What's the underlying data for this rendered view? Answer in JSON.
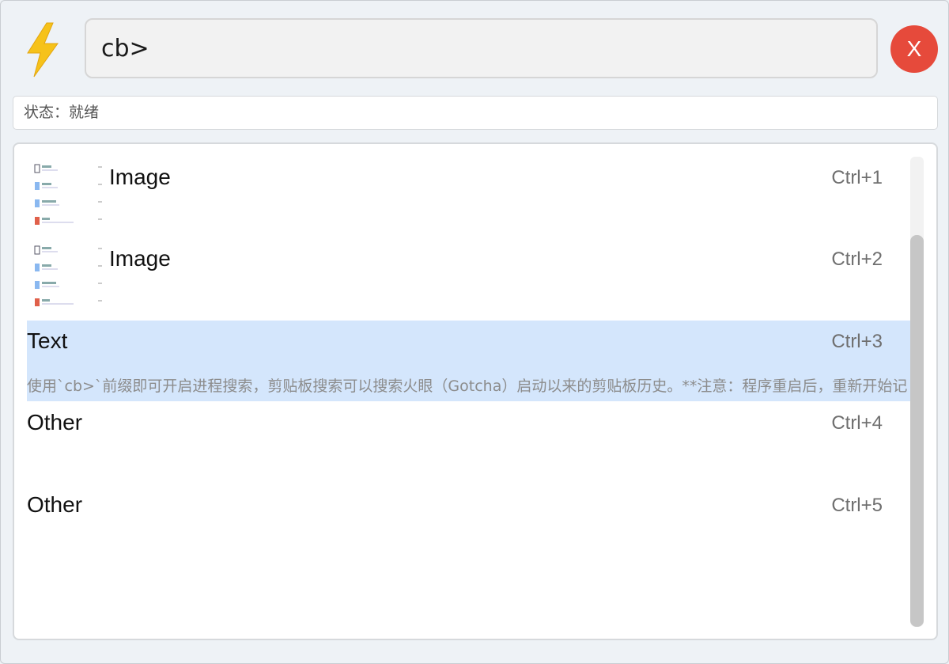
{
  "search": {
    "value": "cb>"
  },
  "close_label": "X",
  "status": {
    "text": "状态：就绪"
  },
  "items": [
    {
      "title": "Image",
      "shortcut": "Ctrl+1",
      "kind": "image"
    },
    {
      "title": "Image",
      "shortcut": "Ctrl+2",
      "kind": "image"
    },
    {
      "title": "Text",
      "shortcut": "Ctrl+3",
      "kind": "text",
      "selected": true,
      "description": "使用`cb>`前缀即可开启进程搜索，剪贴板搜索可以搜索火眼（Gotcha）启动以来的剪贴板历史。**注意：程序重启后，重新开始记"
    },
    {
      "title": "Other",
      "shortcut": "Ctrl+4",
      "kind": "other"
    },
    {
      "title": "Other",
      "shortcut": "Ctrl+5",
      "kind": "other"
    }
  ],
  "colors": {
    "accent_selected": "#d4e6fc",
    "close": "#e64a3b",
    "bolt": "#f6c21a"
  }
}
